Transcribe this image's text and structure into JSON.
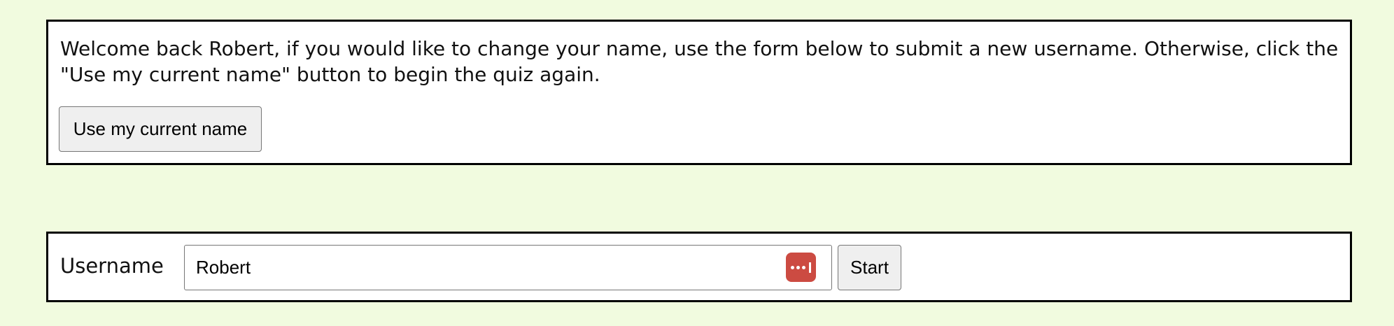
{
  "welcome": {
    "message": "Welcome back Robert, if you would like to change your name, use the form below to submit a new username. Otherwise, click the \"Use my current name\" button to begin the quiz again.",
    "use_current_label": "Use my current name"
  },
  "form": {
    "username_label": "Username",
    "username_value": "Robert",
    "start_label": "Start",
    "password_manager_icon": "password-manager-icon",
    "password_manager_color": "#cc4b42"
  },
  "colors": {
    "background": "#f1fbdf",
    "panel": "#ffffff",
    "border": "#000000"
  }
}
